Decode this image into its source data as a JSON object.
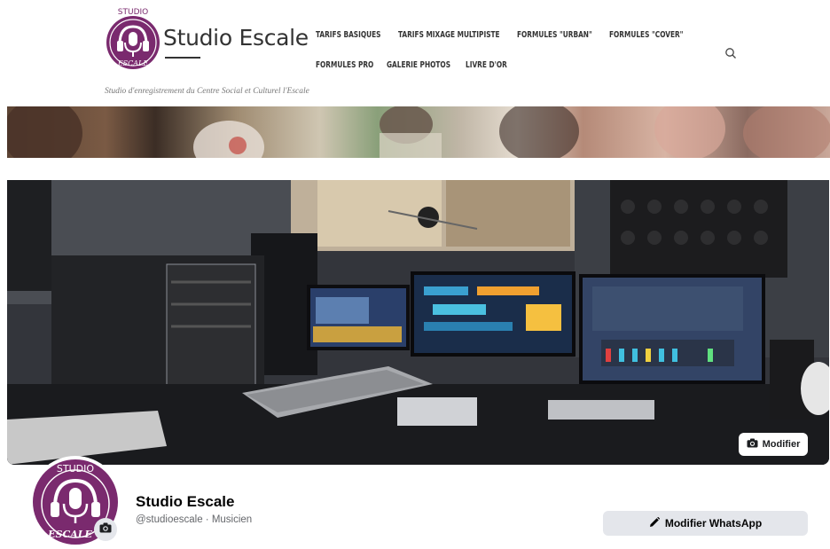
{
  "site": {
    "brand_name": "Studio Escale",
    "logo_text_top": "STUDIO",
    "logo_text_bottom": "ESCALE",
    "tagline": "Studio d'enregistrement du Centre Social et Culturel l'Escale",
    "nav": [
      "TARIFS BASIQUES",
      "TARIFS MIXAGE MULTIPISTE",
      "FORMULES \"URBAN\"",
      "FORMULES \"COVER\"",
      "FORMULES PRO",
      "GALERIE PHOTOS",
      "LIVRE D'OR"
    ],
    "search_icon": "search-icon",
    "brand_color": "#7a2a6e"
  },
  "cover": {
    "edit_label": "Modifier",
    "edit_icon": "camera-icon"
  },
  "profile": {
    "name": "Studio Escale",
    "handle_line": "@studioescale · Musicien",
    "whatsapp_label": "Modifier WhatsApp",
    "whatsapp_icon": "pencil-icon",
    "avatar_icon": "camera-icon"
  }
}
